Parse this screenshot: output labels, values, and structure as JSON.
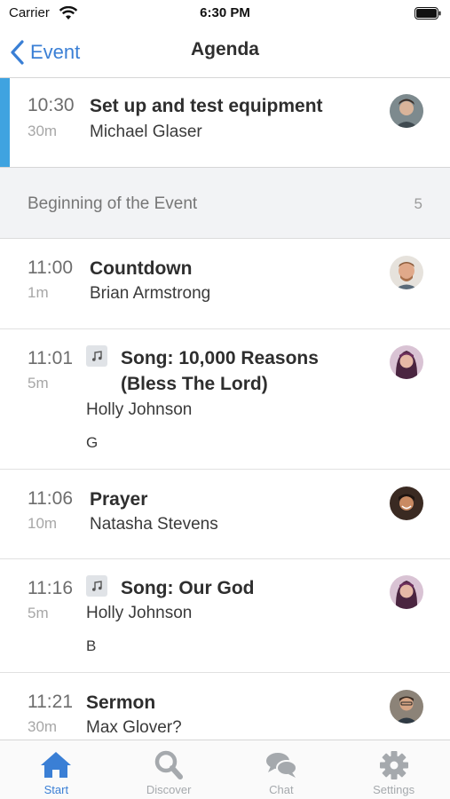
{
  "status_bar": {
    "carrier": "Carrier",
    "time": "6:30 PM"
  },
  "nav": {
    "back_label": "Event",
    "title": "Agenda"
  },
  "current_item": {
    "time": "10:30",
    "duration": "30m",
    "title": "Set up and test equipment",
    "person": "Michael Glaser"
  },
  "section": {
    "title": "Beginning of the Event",
    "count": "5"
  },
  "items": [
    {
      "time": "11:00",
      "duration": "1m",
      "title": "Countdown",
      "person": "Brian Armstrong"
    },
    {
      "time": "11:01",
      "duration": "5m",
      "title_line1": "Song: 10,000 Reasons",
      "title_line2": "(Bless The Lord)",
      "person": "Holly Johnson",
      "key": "G"
    },
    {
      "time": "11:06",
      "duration": "10m",
      "title": "Prayer",
      "person": "Natasha Stevens"
    },
    {
      "time": "11:16",
      "duration": "5m",
      "title": "Song: Our God",
      "person": "Holly Johnson",
      "key": "B"
    },
    {
      "time": "11:21",
      "duration": "30m",
      "title": "Sermon",
      "person": "Max Glover?"
    }
  ],
  "tabs": [
    {
      "label": "Start",
      "icon": "home-icon",
      "active": true
    },
    {
      "label": "Discover",
      "icon": "search-icon",
      "active": false
    },
    {
      "label": "Chat",
      "icon": "chat-icon",
      "active": false
    },
    {
      "label": "Settings",
      "icon": "gear-icon",
      "active": false
    }
  ],
  "colors": {
    "accent": "#3a7fd5",
    "current_marker": "#3fa3e0",
    "section_bg": "#f2f3f5"
  }
}
